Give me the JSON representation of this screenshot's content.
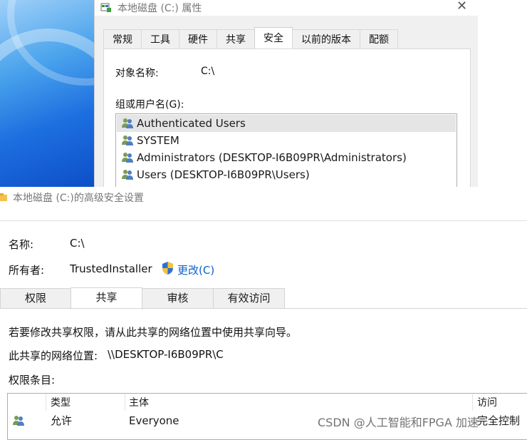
{
  "properties_dialog": {
    "title": "本地磁盘 (C:) 属性",
    "close_glyph": "✕",
    "tabs": [
      {
        "label": "常规",
        "active": false
      },
      {
        "label": "工具",
        "active": false
      },
      {
        "label": "硬件",
        "active": false
      },
      {
        "label": "共享",
        "active": false
      },
      {
        "label": "安全",
        "active": true
      },
      {
        "label": "以前的版本",
        "active": false
      },
      {
        "label": "配额",
        "active": false
      }
    ],
    "object_name_label": "对象名称:",
    "object_name_value": "C:\\",
    "group_label": "组或用户名(G):",
    "users": [
      {
        "name": "Authenticated Users",
        "selected": true
      },
      {
        "name": "SYSTEM",
        "selected": false
      },
      {
        "name": "Administrators (DESKTOP-I6B09PR\\Administrators)",
        "selected": false
      },
      {
        "name": "Users (DESKTOP-I6B09PR\\Users)",
        "selected": false
      }
    ]
  },
  "advanced_dialog": {
    "title": "本地磁盘 (C:)的高级安全设置",
    "name_label": "名称:",
    "name_value": "C:\\",
    "owner_label": "所有者:",
    "owner_value": "TrustedInstaller",
    "change_link": "更改(C)",
    "tabs": [
      {
        "label": "权限",
        "active": false
      },
      {
        "label": "共享",
        "active": true
      },
      {
        "label": "审核",
        "active": false
      },
      {
        "label": "有效访问",
        "active": false
      }
    ],
    "info_text": "若要修改共享权限，请从此共享的网络位置中使用共享向导。",
    "network_path_label": "此共享的网络位置:",
    "network_path_value": "\\\\DESKTOP-I6B09PR\\C",
    "entries_label": "权限条目:",
    "acl_columns": [
      "类型",
      "主体",
      "访问"
    ],
    "acl_rows": [
      {
        "type": "允许",
        "principal": "Everyone",
        "access": "完全控制"
      }
    ]
  },
  "watermark": "CSDN @人工智能和FPGA 加速",
  "colors": {
    "link": "#0a62c9",
    "selection": "#e5e5e5",
    "dialog_bg": "#f0f0f0"
  }
}
